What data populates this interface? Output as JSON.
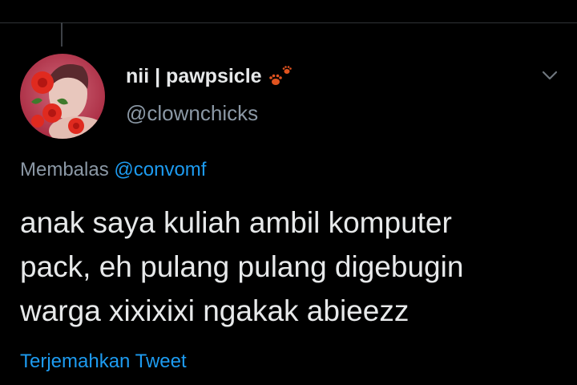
{
  "tweet": {
    "author": {
      "display_name": "nii | pawpsicle",
      "handle": "@clownchicks",
      "name_emoji": "paw-prints-icon"
    },
    "reply": {
      "prefix": "Membalas",
      "mention": "@convomf"
    },
    "text": {
      "line1": "anak saya kuliah ambil komputer",
      "line2": "pack, eh pulang pulang digebugin",
      "line3": "warga xixixixi ngakak abieezz"
    },
    "translate_label": "Terjemahkan Tweet",
    "menu_icon": "chevron-down-icon"
  },
  "colors": {
    "background": "#000000",
    "primary_text": "#e7e9ea",
    "secondary_text": "#8b98a5",
    "accent": "#1d9bf0",
    "paw": "#e0531f"
  }
}
